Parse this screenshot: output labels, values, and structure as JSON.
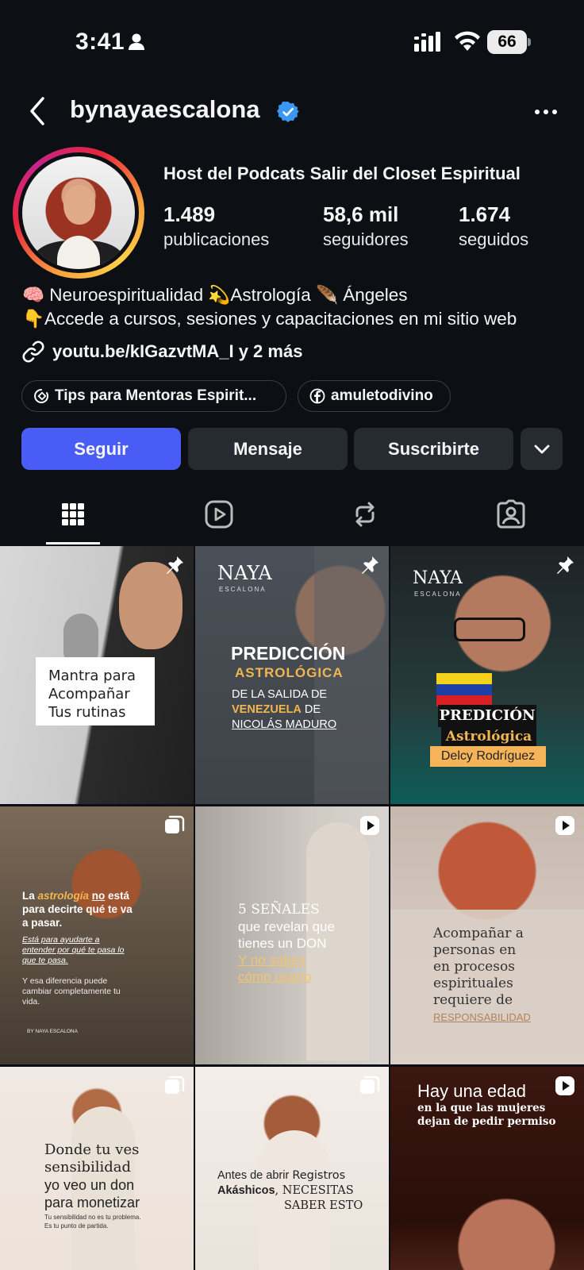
{
  "status_bar": {
    "time": "3:41",
    "battery": "66"
  },
  "header": {
    "username": "bynayaescalona"
  },
  "profile": {
    "title": "Host del Podcats Salir del Closet Espiritual",
    "stats": [
      {
        "value": "1.489",
        "label": "publicaciones"
      },
      {
        "value": "58,6 mil",
        "label": "seguidores"
      },
      {
        "value": "1.674",
        "label": "seguidos"
      }
    ],
    "bio": [
      "🧠 Neuroespiritualidad 💫Astrología 🪶 Ángeles",
      "👇Accede a cursos, sesiones y capacitaciones en mi sitio web"
    ],
    "link": "youtu.be/kIGazvtMA_I y 2 más",
    "chips": [
      {
        "label": "Tips para Mentoras Espirit...",
        "icon": "threads-icon"
      },
      {
        "label": "amuletodivino",
        "icon": "facebook-icon"
      }
    ]
  },
  "actions": {
    "follow": "Seguir",
    "message": "Mensaje",
    "subscribe": "Suscribirte"
  },
  "tabs": [
    "grid-icon",
    "reels-icon",
    "reposts-icon",
    "tagged-icon"
  ],
  "posts": {
    "p1": {
      "lines": [
        "Mantra para",
        "Acompañar",
        "Tus rutinas"
      ],
      "badge": "pin-icon"
    },
    "p2": {
      "brand": "NAYA",
      "brand_sub": "ESCALONA",
      "title": "PREDICCIÓN",
      "sub": "ASTROLÓGICA",
      "line1": "DE LA SALIDA DE",
      "line2_hl": "VENEZUELA",
      "line2_rest": " DE",
      "line3": "NICOLÁS MADURO",
      "badge": "pin-icon"
    },
    "p3": {
      "brand": "NAYA",
      "brand_sub": "ESCALONA",
      "title": "PREDICIÓN",
      "sub": "Astrológica",
      "name": "Delcy Rodríguez",
      "badge": "pin-icon"
    },
    "p4": {
      "l1a": "La ",
      "l1b": "astrología",
      "l1c": " ",
      "l1d": "no",
      "l1e": " está",
      "l2": "para decirte qué te va",
      "l3": "a pasar.",
      "l4": "Está para ayudarte a",
      "l5": "entender por qué te pasa lo",
      "l6": "que te pasa.",
      "l7": "Y esa diferencia puede",
      "l8": "cambiar completamente tu",
      "l9": "vida.",
      "footer": "BY NAYA ESCALONA",
      "badge": "carousel-icon"
    },
    "p5": {
      "l1": "5 SEÑALES",
      "l2": "que revelan que",
      "l3": "tienes un DON",
      "l4": "Y no sabes",
      "l5": "cómo usarlo",
      "badge": "reel-icon"
    },
    "p6": {
      "l1": "Acompañar a",
      "l2": "personas en",
      "l3": "en procesos",
      "l4": "espirituales",
      "l5": "requiere de",
      "l6": "RESPONSABILIDAD",
      "badge": "reel-icon"
    },
    "p7": {
      "l1": "Donde tu ves",
      "l2": "sensibilidad",
      "l3": "yo veo un don",
      "l4": "para monetizar",
      "l5": "Tu sensibilidad no es tu problema.",
      "l6": "Es tu punto de partida.",
      "badge": "carousel-icon"
    },
    "p8": {
      "l1a": "Antes de abrir ",
      "l1b": "Registros",
      "l2a": "Akáshicos",
      "l2b": ", NECESITAS",
      "l3": "SABER ESTO",
      "badge": "carousel-icon"
    },
    "p9": {
      "l1": "Hay una edad",
      "l2": "en la que las mujeres",
      "l3": "dejan de pedir permiso",
      "badge": "reel-icon"
    }
  },
  "colors": {
    "accent": "#4a5cf6",
    "verified": "#3a97f3",
    "background": "#0c0f14",
    "gold": "#f1b64f"
  }
}
